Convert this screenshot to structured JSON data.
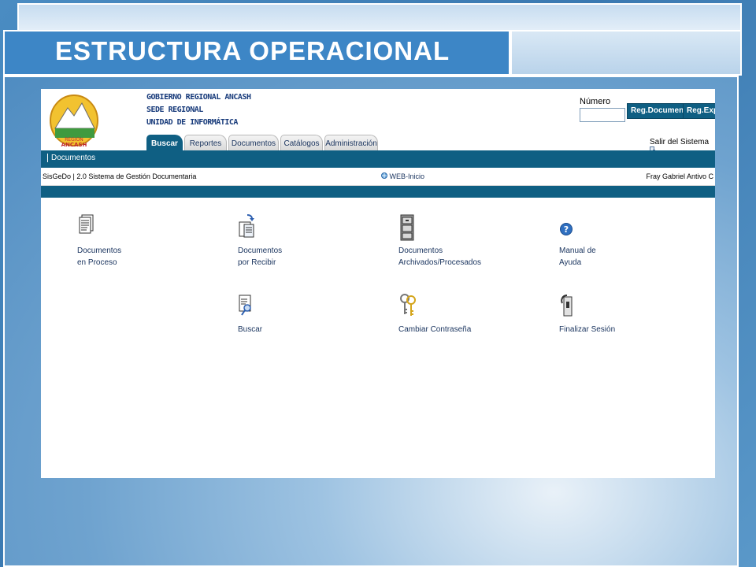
{
  "slide": {
    "title": "ESTRUCTURA OPERACIONAL"
  },
  "app": {
    "org_lines": [
      "GOBIERNO REGIONAL ANCASH",
      "SEDE REGIONAL",
      "UNIDAD DE INFORMÁTICA"
    ],
    "logo_text": {
      "top": "REGION",
      "bottom": "ANCASH"
    },
    "numero_label": "Número",
    "numero_value": "",
    "buttons": {
      "reg_documento": "Reg.Documento",
      "reg_expediente": "Reg.Exped"
    },
    "salir": "Salir del Sistema",
    "tabs": [
      {
        "label": "Buscar",
        "active": true
      },
      {
        "label": "Reportes",
        "active": false
      },
      {
        "label": "Documentos",
        "active": false
      },
      {
        "label": "Catálogos",
        "active": false
      },
      {
        "label": "Administración",
        "active": false
      }
    ],
    "navbar": {
      "item": "Documentos"
    },
    "infobar": {
      "left": "SisGeDo | 2.0  Sistema de Gestión Documentaria",
      "mid": "WEB-Inicio",
      "right": "Fray Gabriel Antivo C"
    },
    "menu": {
      "docs_proceso": {
        "line1": "Documentos",
        "line2": "en Proceso",
        "icon": "document-stack-icon"
      },
      "docs_recibir": {
        "line1": "Documentos",
        "line2": "por Recibir",
        "icon": "receive-document-icon"
      },
      "docs_archivados": {
        "line1": "Documentos",
        "line2": "Archivados/Procesados",
        "icon": "file-cabinet-icon"
      },
      "manual": {
        "line1": "Manual de",
        "line2": "Ayuda",
        "icon": "help-icon"
      },
      "buscar": {
        "line1": "Buscar",
        "icon": "search-document-icon"
      },
      "cambiar": {
        "line1": "Cambiar Contraseña",
        "icon": "keys-icon"
      },
      "finalizar": {
        "line1": "Finalizar Sesión",
        "icon": "logout-icon"
      }
    }
  },
  "colors": {
    "brand": "#0f5f83",
    "slide_blue": "#3d86c6"
  }
}
